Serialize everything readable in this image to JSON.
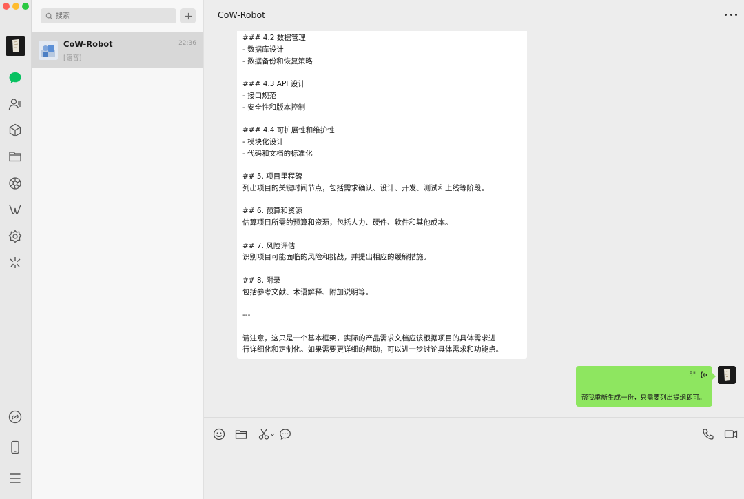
{
  "sidebar": {
    "icons": [
      "chat-icon",
      "contacts-icon",
      "favorites-icon",
      "files-icon",
      "moments-icon",
      "channels-icon",
      "mini-programs-icon",
      "search-discover-icon",
      "link-icon",
      "phone-icon",
      "menu-icon"
    ],
    "accent_color": "#07c160"
  },
  "search": {
    "placeholder": "搜索"
  },
  "conversation_list": [
    {
      "name": "CoW-Robot",
      "time": "22:36",
      "preview": "[语音]"
    }
  ],
  "chat": {
    "title": "CoW-Robot",
    "bot_message_lines": [
      "### 4.2 数据管理",
      "- 数据库设计",
      "- 数据备份和恢复策略",
      "",
      "### 4.3 API 设计",
      "- 接口规范",
      "- 安全性和版本控制",
      "",
      "### 4.4 可扩展性和维护性",
      "- 模块化设计",
      "- 代码和文档的标准化",
      "",
      "## 5. 项目里程碑",
      "列出项目的关键时间节点，包括需求确认、设计、开发、测试和上线等阶段。",
      "",
      "## 6. 预算和资源",
      "估算项目所需的预算和资源，包括人力、硬件、软件和其他成本。",
      "",
      "## 7. 风险评估",
      "识别项目可能面临的风险和挑战，并提出相应的缓解措施。",
      "",
      "## 8. 附录",
      "包括参考文献、术语解释、附加说明等。",
      "",
      "---",
      "",
      "请注意，这只是一个基本框架，实际的产品需求文档应该根据项目的具体需求进",
      "行详细化和定制化。如果需要更详细的帮助，可以进一步讨论具体需求和功能点。"
    ],
    "user_voice": {
      "duration": "5\"",
      "transcript": "帮我重新生成一份，只需要列出提纲即可。"
    },
    "user_bubble_color": "#8ee660"
  },
  "toolbar": {
    "left": [
      "emoji-icon",
      "folder-icon",
      "scissors-icon",
      "chat-history-icon"
    ],
    "right": [
      "phone-call-icon",
      "video-call-icon"
    ]
  }
}
